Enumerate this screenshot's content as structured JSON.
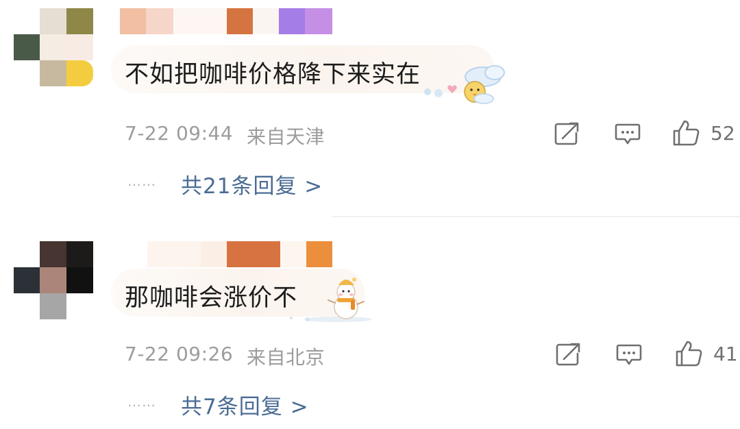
{
  "comments": [
    {
      "text": "不如把咖啡价格降下来实在",
      "date": "7-22 09:44",
      "location": "来自天津",
      "likes": "52",
      "replies_label": "共21条回复 >",
      "dots": "……",
      "avatar_icon": "pixelated-avatar",
      "username_icon": "pixelated-username",
      "bubble_decoration": "chick-and-clouds-sticker"
    },
    {
      "text": "那咖啡会涨价不",
      "date": "7-22 09:26",
      "location": "来自北京",
      "likes": "41",
      "replies_label": "共7条回复 >",
      "dots": "……",
      "avatar_icon": "pixelated-avatar",
      "username_icon": "pixelated-username",
      "bubble_decoration": "snowman-sticker"
    }
  ],
  "actions": {
    "share_icon": "share-icon",
    "comment_icon": "comment-icon",
    "like_icon": "thumbs-up-icon"
  },
  "colors": {
    "text": "#1c1c1c",
    "meta": "#9c9c9c",
    "replies": "#4a6b94",
    "icon": "#6f6f6f"
  }
}
